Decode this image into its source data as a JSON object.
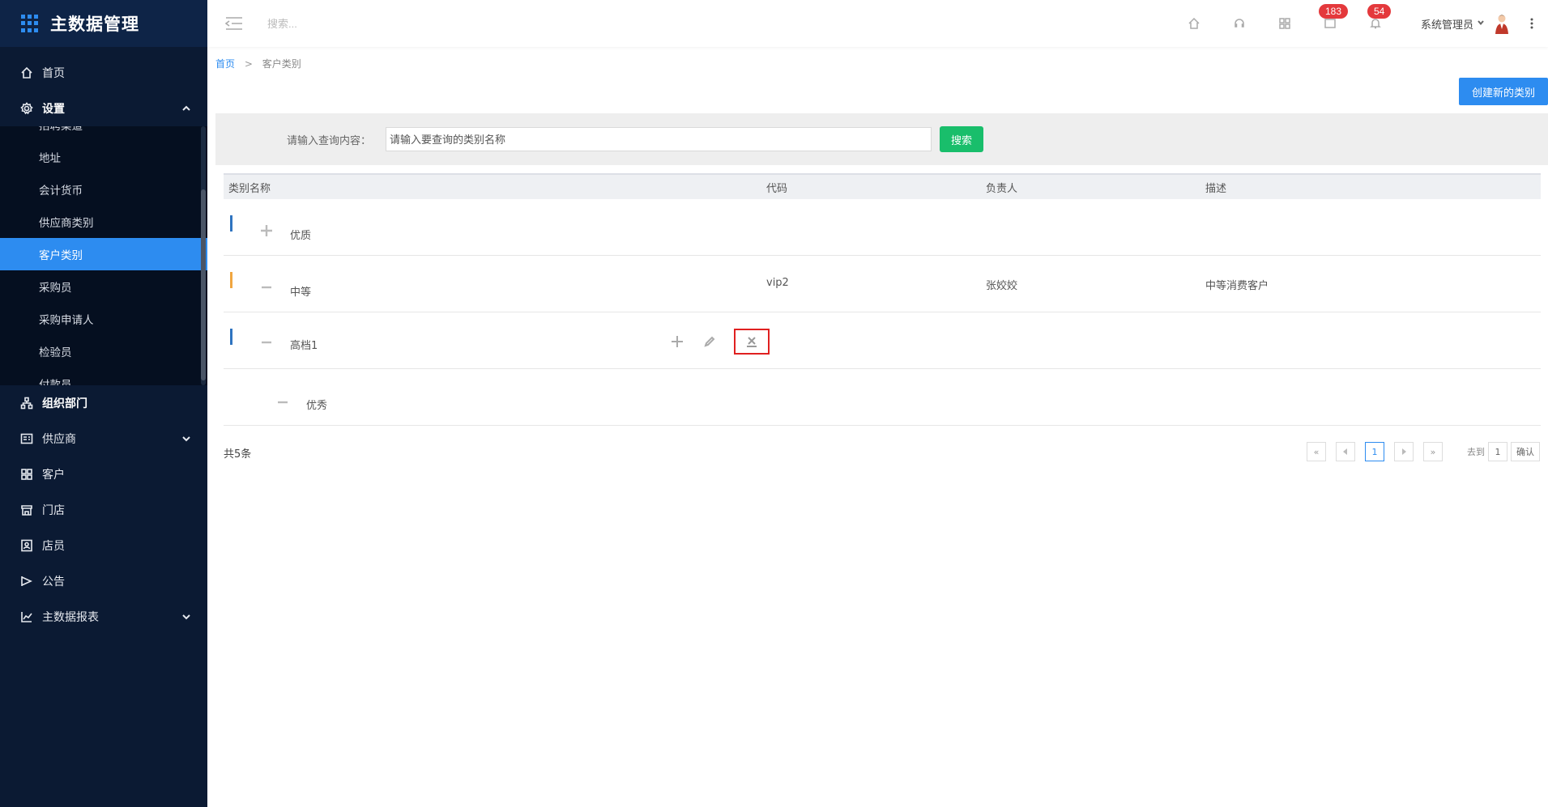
{
  "app": {
    "title": "主数据管理"
  },
  "sidebar": {
    "top_items": [
      {
        "label": "首页",
        "icon": "home-icon"
      },
      {
        "label": "设置",
        "icon": "gear-icon",
        "expanded": true
      }
    ],
    "sub_items": [
      {
        "label": "招聘渠道"
      },
      {
        "label": "地址"
      },
      {
        "label": "会计货币"
      },
      {
        "label": "供应商类别"
      },
      {
        "label": "客户类别",
        "active": true
      },
      {
        "label": "采购员"
      },
      {
        "label": "采购申请人"
      },
      {
        "label": "检验员"
      },
      {
        "label": "付款员"
      }
    ],
    "bottom_items": [
      {
        "label": "组织部门",
        "icon": "org-icon"
      },
      {
        "label": "供应商",
        "icon": "supplier-icon",
        "has_children": true
      },
      {
        "label": "客户",
        "icon": "customer-icon"
      },
      {
        "label": "门店",
        "icon": "store-icon"
      },
      {
        "label": "店员",
        "icon": "clerk-icon"
      },
      {
        "label": "公告",
        "icon": "announce-icon"
      },
      {
        "label": "主数据报表",
        "icon": "report-icon",
        "has_children": true
      }
    ]
  },
  "header": {
    "search_placeholder": "搜索...",
    "badges": {
      "mail": "183",
      "bell": "54"
    },
    "user": "系统管理员"
  },
  "breadcrumb": {
    "home": "首页",
    "sep": ">",
    "current": "客户类别"
  },
  "actions": {
    "create_label": "创建新的类别"
  },
  "filter": {
    "label": "请输入查询内容：",
    "placeholder": "请输入要查询的类别名称",
    "search_label": "搜索"
  },
  "table": {
    "headers": [
      "类别名称",
      "代码",
      "负责人",
      "描述"
    ],
    "rows": [
      {
        "name": "优质",
        "code": "",
        "owner": "",
        "desc": "",
        "toggle": "plus",
        "bar_color": "#2f74c0"
      },
      {
        "name": "中等",
        "code": "vip2",
        "owner": "张姣姣",
        "desc": "中等消费客户",
        "toggle": "minus",
        "bar_color": "#f0a640"
      },
      {
        "name": "高档1",
        "code": "",
        "owner": "",
        "desc": "",
        "toggle": "minus",
        "bar_color": "#2f74c0"
      },
      {
        "name": "优秀",
        "code": "",
        "owner": "",
        "desc": "",
        "toggle": "minus",
        "bar_color": ""
      }
    ]
  },
  "pagination": {
    "total": "共5条",
    "first": "«",
    "last": "»",
    "current": "1",
    "goto_label": "去到",
    "goto_value": "1",
    "confirm": "确认"
  },
  "colors": {
    "accent": "#2d8cf0",
    "sidebar_bg": "#0b1a33",
    "success": "#19be6b",
    "danger": "#e02020"
  }
}
